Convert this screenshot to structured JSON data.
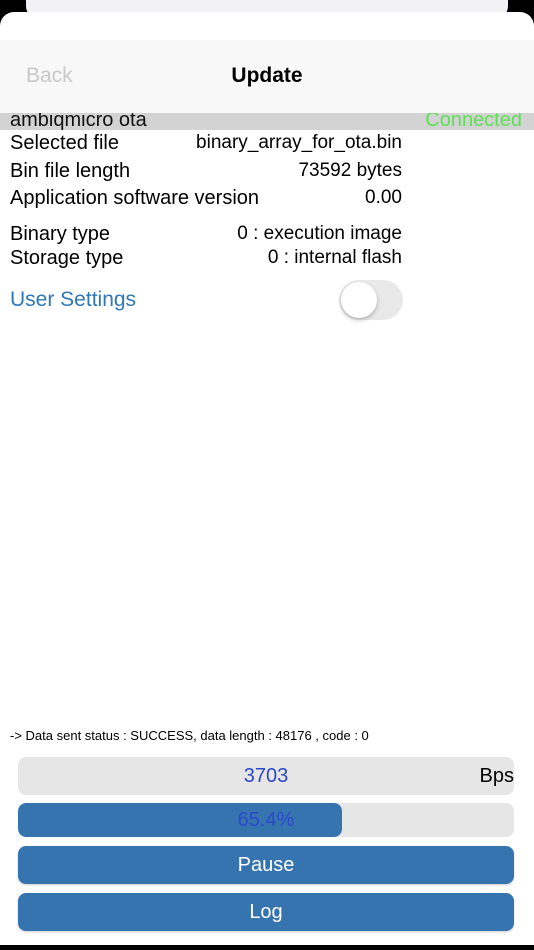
{
  "nav": {
    "back_label": "Back",
    "title": "Update"
  },
  "device": {
    "name": "ambiqmicro ota",
    "status": "Connected",
    "status_color": "#5ee057"
  },
  "info": {
    "selected_file": {
      "label": "Selected file",
      "value": "binary_array_for_ota.bin"
    },
    "bin_length": {
      "label": "Bin file length",
      "value": "73592 bytes"
    },
    "app_version": {
      "label": "Application software version",
      "value": "0.00"
    },
    "binary_type": {
      "label": "Binary type",
      "value": "0 : execution image"
    },
    "storage_type": {
      "label": "Storage type",
      "value": "0 : internal flash"
    }
  },
  "user_settings": {
    "label": "User Settings",
    "toggle_on": false
  },
  "status_line": "-> Data sent status : SUCCESS, data length : 48176 , code : 0",
  "rate": {
    "value": "3703",
    "unit": "Bps"
  },
  "progress": {
    "percent": 65.4,
    "label": "65.4%"
  },
  "buttons": {
    "pause": "Pause",
    "log": "Log"
  },
  "colors": {
    "accent": "#3674b0",
    "link": "#2e78b7",
    "value_text": "#2a49c9"
  }
}
